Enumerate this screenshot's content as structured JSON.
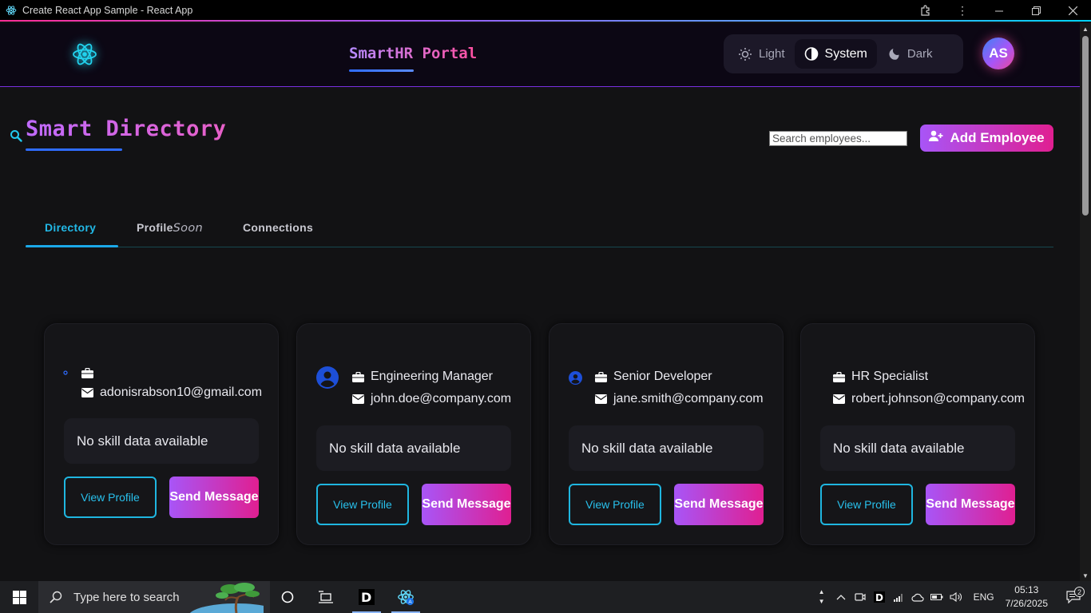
{
  "window": {
    "title": "Create React App Sample - React App"
  },
  "header": {
    "brand": "SmartHR Portal",
    "theme_options": [
      {
        "label": "Light",
        "icon": "sun-icon"
      },
      {
        "label": "System",
        "icon": "half-circle-icon",
        "active": true
      },
      {
        "label": "Dark",
        "icon": "moon-icon"
      }
    ],
    "avatar_initials": "AS"
  },
  "main": {
    "title": "Smart Directory",
    "search_placeholder": "Search employees...",
    "add_button": "Add Employee",
    "tabs": [
      {
        "label": "Directory",
        "active": true
      },
      {
        "label": "Profile",
        "badge": "Soon"
      },
      {
        "label": "Connections"
      }
    ]
  },
  "cards": [
    {
      "role": "",
      "email": "adonisrabson10@gmail.com",
      "skills": "No skill data available",
      "view": "View Profile",
      "message": "Send Message"
    },
    {
      "role": "Engineering Manager",
      "email": "john.doe@company.com",
      "skills": "No skill data available",
      "view": "View Profile",
      "message": "Send Message"
    },
    {
      "role": "Senior Developer",
      "email": "jane.smith@company.com",
      "skills": "No skill data available",
      "view": "View Profile",
      "message": "Send Message"
    },
    {
      "role": "HR Specialist",
      "email": "robert.johnson@company.com",
      "skills": "No skill data available",
      "view": "View Profile",
      "message": "Send Message"
    }
  ],
  "taskbar": {
    "search_placeholder": "Type here to search",
    "language": "ENG",
    "time": "05:13",
    "date": "7/26/2025",
    "notifications": "2"
  },
  "colors": {
    "accent_purple": "#a855f7",
    "accent_pink": "#e01f91",
    "accent_cyan": "#1fb6e0",
    "background": "#121214"
  }
}
